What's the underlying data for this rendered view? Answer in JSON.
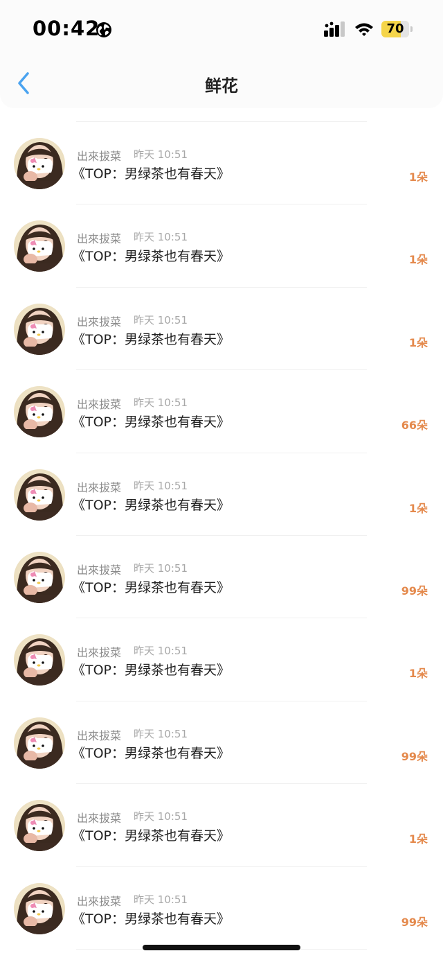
{
  "status_bar": {
    "time": "00:42",
    "battery_level": "70",
    "icons": [
      "globe-icon",
      "signal-icon",
      "wifi-icon",
      "battery-icon"
    ]
  },
  "header": {
    "title": "鲜花",
    "back_icon": "chevron-left-icon"
  },
  "colors": {
    "accent": "#e4894c",
    "back_arrow": "#4aa3f0",
    "battery": "#f5d54a"
  },
  "items": [
    {
      "sender": "出來拔菜",
      "time": "昨天 10:51",
      "title": "《TOP：男绿茶也有春天》",
      "count": "1朵"
    },
    {
      "sender": "出來拔菜",
      "time": "昨天 10:51",
      "title": "《TOP：男绿茶也有春天》",
      "count": "1朵"
    },
    {
      "sender": "出來拔菜",
      "time": "昨天 10:51",
      "title": "《TOP：男绿茶也有春天》",
      "count": "1朵"
    },
    {
      "sender": "出來拔菜",
      "time": "昨天 10:51",
      "title": "《TOP：男绿茶也有春天》",
      "count": "66朵"
    },
    {
      "sender": "出來拔菜",
      "time": "昨天 10:51",
      "title": "《TOP：男绿茶也有春天》",
      "count": "1朵"
    },
    {
      "sender": "出來拔菜",
      "time": "昨天 10:51",
      "title": "《TOP：男绿茶也有春天》",
      "count": "99朵"
    },
    {
      "sender": "出來拔菜",
      "time": "昨天 10:51",
      "title": "《TOP：男绿茶也有春天》",
      "count": "1朵"
    },
    {
      "sender": "出來拔菜",
      "time": "昨天 10:51",
      "title": "《TOP：男绿茶也有春天》",
      "count": "99朵"
    },
    {
      "sender": "出來拔菜",
      "time": "昨天 10:51",
      "title": "《TOP：男绿茶也有春天》",
      "count": "1朵"
    },
    {
      "sender": "出來拔菜",
      "time": "昨天 10:51",
      "title": "《TOP：男绿茶也有春天》",
      "count": "99朵"
    }
  ]
}
